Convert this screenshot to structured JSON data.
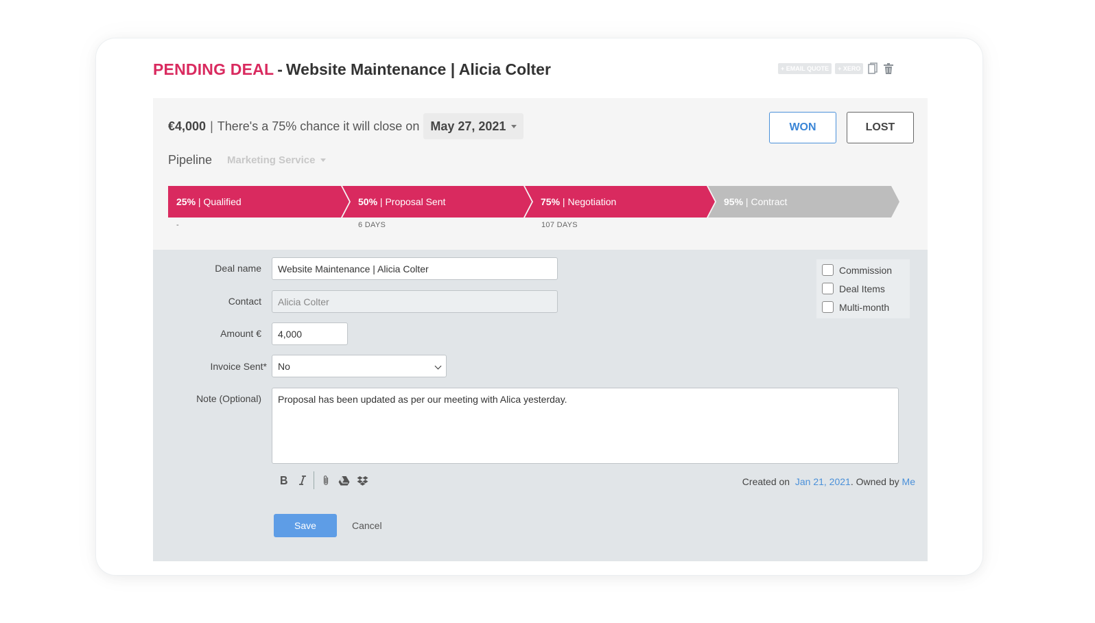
{
  "header": {
    "status": "PENDING DEAL",
    "separator": "-",
    "title": "Website Maintenance | Alicia Colter",
    "tools": {
      "email_quote": "+ EMAIL QUOTE",
      "xero": "+ XERO",
      "copy_icon": "copy-icon",
      "delete_icon": "trash-icon"
    }
  },
  "summary": {
    "amount": "€4,000",
    "pipe": "|",
    "chance_text": "There's a 75% chance it will close on",
    "close_date": "May 27, 2021",
    "won_label": "WON",
    "lost_label": "LOST",
    "pipeline_label": "Pipeline",
    "pipeline_value": "Marketing Service"
  },
  "stages": [
    {
      "percent": "25%",
      "name": "Qualified",
      "days": "-",
      "active": true
    },
    {
      "percent": "50%",
      "name": "Proposal Sent",
      "days": "6 DAYS",
      "active": true
    },
    {
      "percent": "75%",
      "name": "Negotiation",
      "days": "107 DAYS",
      "active": true
    },
    {
      "percent": "95%",
      "name": "Contract",
      "days": "",
      "active": false
    }
  ],
  "stage_pipe": "|",
  "colors": {
    "accent": "#d92a5f",
    "inactive_stage": "#bdbdbd",
    "link": "#4a90d9",
    "save": "#5e9de6"
  },
  "form": {
    "deal_name_label": "Deal name",
    "deal_name_value": "Website Maintenance | Alicia Colter",
    "contact_label": "Contact",
    "contact_placeholder": "Alicia Colter",
    "amount_label": "Amount €",
    "amount_value": "4,000",
    "invoice_label": "Invoice Sent*",
    "invoice_value": "No",
    "note_label": "Note (Optional)",
    "note_value": "Proposal has been updated as per our meeting with Alica yesterday.",
    "checkboxes": [
      "Commission",
      "Deal Items",
      "Multi-month"
    ],
    "toolbar_icons": [
      "bold-icon",
      "italic-icon",
      "attachment-icon",
      "google-drive-icon",
      "dropbox-icon"
    ],
    "created_prefix": "Created on",
    "created_date": "Jan 21, 2021",
    "owned_prefix": ". Owned by",
    "owner": "Me",
    "save_label": "Save",
    "cancel_label": "Cancel"
  }
}
